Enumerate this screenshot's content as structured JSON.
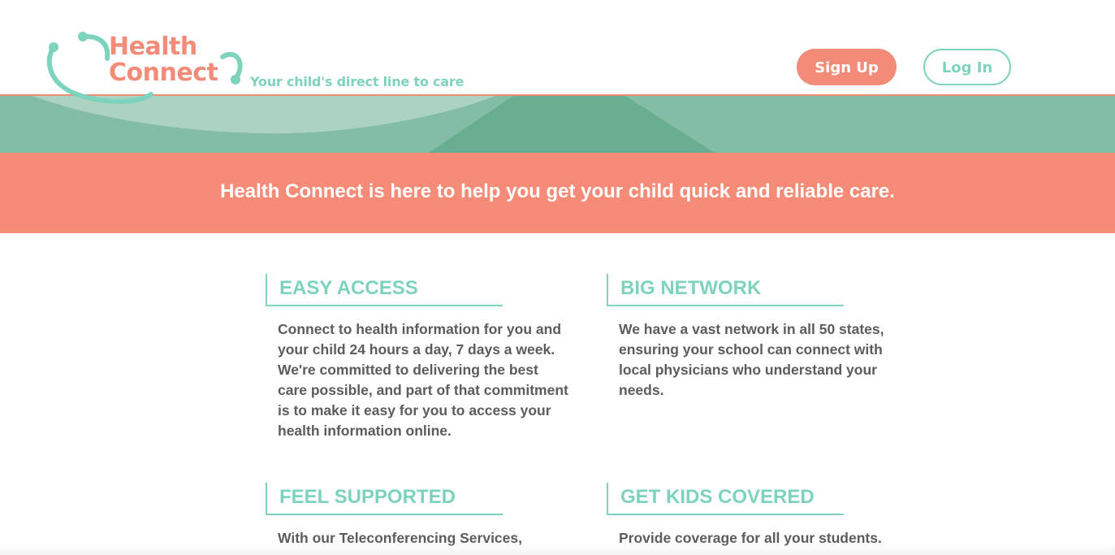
{
  "header": {
    "logo_line1": "Health",
    "logo_line2": "Connect",
    "tagline": "Your child's direct line to care",
    "signup_label": "Sign Up",
    "login_label": "Log In"
  },
  "banner": {
    "message": "Health Connect is here to help you get your child quick and reliable care."
  },
  "features": [
    {
      "title": "EASY ACCESS",
      "body": "Connect to health information for you and your child 24 hours a day, 7 days a week. We're committed to delivering the best care possible, and part of that commitment is to make it easy for you to access your health information online."
    },
    {
      "title": "BIG NETWORK",
      "body": "We have a vast network in all 50 states, ensuring your school can connect with local physicians who understand your needs."
    },
    {
      "title": "FEEL SUPPORTED",
      "body": "With our Teleconferencing Services,"
    },
    {
      "title": "GET KIDS COVERED",
      "body": "Provide coverage for all your students."
    }
  ],
  "colors": {
    "salmon": "#f68b77",
    "mint": "#7dd3bd",
    "green_banner": "#84bda5",
    "body_text": "#5c5c5c"
  },
  "icons": {
    "logo": "stethoscope-icon"
  }
}
